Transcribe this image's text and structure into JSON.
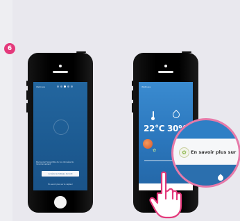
{
  "step": {
    "number": "6"
  },
  "phone1": {
    "header": "Wellness",
    "dots": 5,
    "active_dot": 3,
    "body_text": "Découvrez l'ensemble de vos données de l'environnement",
    "primary_button": "Accéder au tableau de bord",
    "secondary_link": "En savoir plus sur le capteur"
  },
  "phone2": {
    "header": "Wellness",
    "temperature": "22°C",
    "humidity": "30%",
    "bottom_bar_text": "En savoir plus"
  },
  "zoom": {
    "label": "En savoir plus sur"
  },
  "colors": {
    "accent": "#e4397b",
    "zoom_border": "#e67aa9",
    "screen_blue": "#1c5a91"
  }
}
